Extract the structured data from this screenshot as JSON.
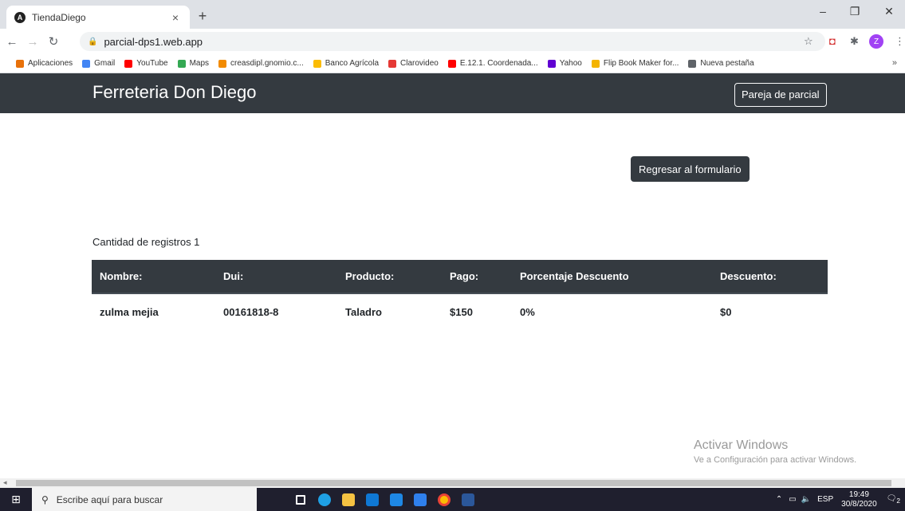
{
  "browser": {
    "tab_title": "TiendaDiego",
    "tab_close": "×",
    "new_tab": "+",
    "url": "parcial-dps1.web.app",
    "profile_initial": "Z",
    "window_controls": [
      "–",
      "❐",
      "✕"
    ]
  },
  "bookmarks": [
    {
      "label": "Aplicaciones",
      "color": "#e8710a"
    },
    {
      "label": "Gmail",
      "color": "#4285f4"
    },
    {
      "label": "YouTube",
      "color": "#ff0000"
    },
    {
      "label": "Maps",
      "color": "#34a853"
    },
    {
      "label": "creasdipl.gnomio.c...",
      "color": "#f28b00"
    },
    {
      "label": "Banco Agrícola",
      "color": "#fbbc04"
    },
    {
      "label": "Clarovideo",
      "color": "#e53935"
    },
    {
      "label": "E.12.1. Coordenada...",
      "color": "#ff0000"
    },
    {
      "label": "Yahoo",
      "color": "#6001d2"
    },
    {
      "label": "Flip Book Maker for...",
      "color": "#f4b400"
    },
    {
      "label": "Nueva pestaña",
      "color": "#5f6368"
    }
  ],
  "bookmarks_more": "»",
  "navbar": {
    "brand": "Ferreteria Don Diego",
    "pair_button": "Pareja de parcial"
  },
  "main": {
    "back_button": "Regresar al formulario",
    "count_label": "Cantidad de registros 1",
    "table": {
      "headers": [
        "Nombre:",
        "Dui:",
        "Producto:",
        "Pago:",
        "Porcentaje Descuento",
        "Descuento:"
      ],
      "rows": [
        [
          "zulma mejia",
          "00161818-8",
          "Taladro",
          "$150",
          "0%",
          "$0"
        ]
      ]
    }
  },
  "watermark": {
    "title": "Activar Windows",
    "subtitle": "Ve a Configuración para activar Windows."
  },
  "taskbar": {
    "search_placeholder": "Escribe aquí para buscar",
    "language": "ESP",
    "time": "19:49",
    "date": "30/8/2020",
    "notification_count": "2"
  }
}
